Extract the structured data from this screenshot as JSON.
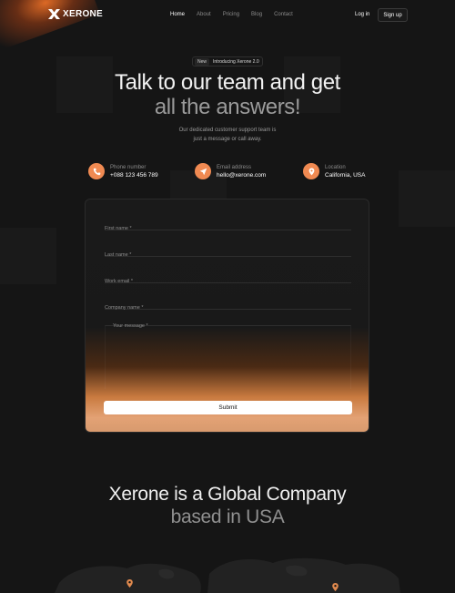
{
  "brand": {
    "name": "XERONE",
    "accent": "#f08a52"
  },
  "nav": {
    "links": [
      "Home",
      "About",
      "Pricing",
      "Blog",
      "Contact"
    ],
    "active": "Home",
    "login": "Log in",
    "signup": "Sign up"
  },
  "hero": {
    "badge_tag": "New",
    "badge_text": "Introducing Xerone 2.0",
    "title_line1": "Talk to our team and get",
    "title_line2": "all the answers!",
    "subtitle_line1": "Our dedicated customer support team is",
    "subtitle_line2": "just a message or call away."
  },
  "contact": [
    {
      "icon": "phone-icon",
      "label": "Phone number",
      "value": "+088 123 456 789"
    },
    {
      "icon": "send-icon",
      "label": "Email address",
      "value": "hello@xerone.com"
    },
    {
      "icon": "location-pin-icon",
      "label": "Location",
      "value": "California, USA"
    }
  ],
  "form": {
    "first_name": "First name *",
    "last_name": "Last name *",
    "work_email": "Work email *",
    "company_name": "Company name *",
    "message": "Your message *",
    "submit": "Submit"
  },
  "global": {
    "line1": "Xerone is a Global Company",
    "line2": "based in USA"
  }
}
